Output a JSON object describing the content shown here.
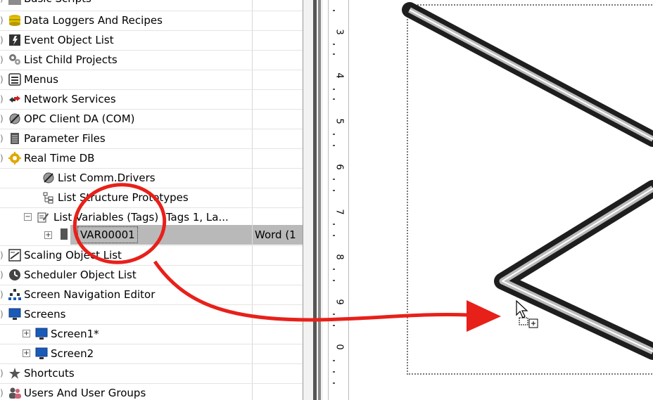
{
  "tree": {
    "items": [
      {
        "label": "Basic Scripts",
        "icon": "script-icon"
      },
      {
        "label": "Data Loggers And Recipes",
        "icon": "database-icon"
      },
      {
        "label": "Event Object List",
        "icon": "event-icon"
      },
      {
        "label": "List Child Projects",
        "icon": "gears-icon"
      },
      {
        "label": "Menus",
        "icon": "menu-icon"
      },
      {
        "label": "Network Services",
        "icon": "arrows-icon"
      },
      {
        "label": "OPC Client DA (COM)",
        "icon": "plug-icon"
      },
      {
        "label": "Parameter Files",
        "icon": "file-icon"
      },
      {
        "label": "Real Time DB",
        "icon": "gear-icon"
      },
      {
        "label": "List Comm.Drivers",
        "icon": "plug-icon"
      },
      {
        "label": "List Structure Prototypes",
        "icon": "structure-icon"
      },
      {
        "label": "List Variables (Tags) (Tags 1, La...",
        "icon": "variables-icon"
      },
      {
        "label": "VAR00001",
        "icon": "tag-icon"
      },
      {
        "label": "Scaling Object List",
        "icon": "scaling-icon"
      },
      {
        "label": "Scheduler Object List",
        "icon": "clock-icon"
      },
      {
        "label": "Screen Navigation Editor",
        "icon": "navigation-icon"
      },
      {
        "label": "Screens",
        "icon": "monitor-icon"
      },
      {
        "label": "Screen1*",
        "icon": "monitor-icon"
      },
      {
        "label": "Screen2",
        "icon": "monitor-icon"
      },
      {
        "label": "Shortcuts",
        "icon": "shortcut-icon"
      },
      {
        "label": "Users And User Groups",
        "icon": "users-icon"
      }
    ],
    "selected_type": "Word (1"
  },
  "ruler": {
    "labels": [
      "3",
      "4",
      "5",
      "6",
      "7",
      "8",
      "9",
      "0"
    ]
  },
  "colors": {
    "annotation": "#e8201a",
    "selection": "#b9b9b9"
  }
}
